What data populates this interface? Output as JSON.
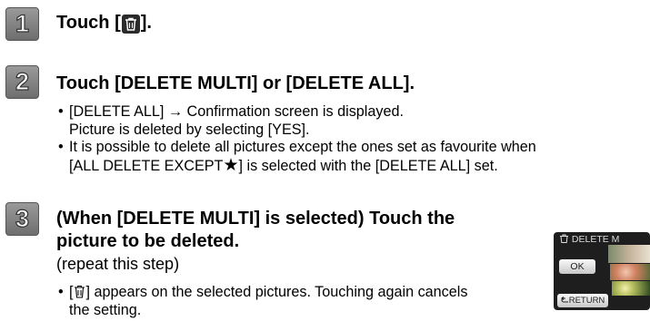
{
  "steps": [
    {
      "number": "1",
      "heading_before": "Touch [",
      "heading_icon": "trash-icon",
      "heading_after": "]."
    },
    {
      "number": "2",
      "heading": "Touch [DELETE MULTI] or [DELETE ALL].",
      "bullets": [
        {
          "line1": "[DELETE ALL] → Confirmation screen is displayed.",
          "line2": "Picture is deleted by selecting [YES]."
        },
        {
          "line1": "It is possible to delete all pictures except the ones set as favourite when",
          "line2_before": "[ALL DELETE EXCEPT",
          "line2_star": "★",
          "line2_after": "] is selected with the [DELETE ALL] set."
        }
      ]
    },
    {
      "number": "3",
      "heading_line1": "(When [DELETE MULTI] is selected) Touch the",
      "heading_line2": "picture to be deleted.",
      "subheading": "(repeat this step)",
      "bullets": [
        {
          "line1_before": "[",
          "line1_icon": "trash-icon",
          "line1_after": "] appears on the selected pictures. Touching again cancels",
          "line2": "the setting."
        }
      ]
    }
  ],
  "camera_screen": {
    "title": "DELETE M",
    "ok_label": "OK",
    "return_label": "RETURN",
    "icons": [
      "trash-icon",
      "return-arrow-icon"
    ]
  }
}
